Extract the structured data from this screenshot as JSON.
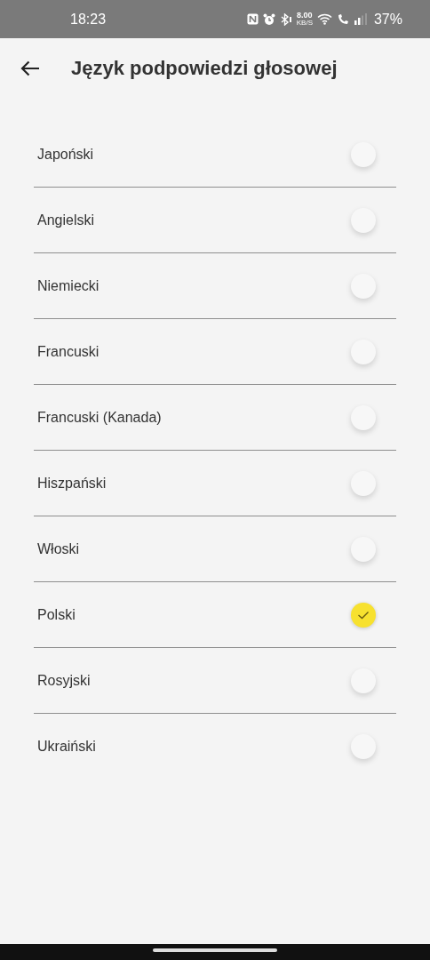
{
  "status_bar": {
    "time": "18:23",
    "speed_value": "8.00",
    "speed_unit": "KB/S",
    "battery": "37%"
  },
  "header": {
    "title": "Język podpowiedzi głosowej"
  },
  "languages": [
    {
      "label": "Japoński",
      "selected": false
    },
    {
      "label": "Angielski",
      "selected": false
    },
    {
      "label": "Niemiecki",
      "selected": false
    },
    {
      "label": "Francuski",
      "selected": false
    },
    {
      "label": "Francuski (Kanada)",
      "selected": false
    },
    {
      "label": "Hiszpański",
      "selected": false
    },
    {
      "label": "Włoski",
      "selected": false
    },
    {
      "label": "Polski",
      "selected": true
    },
    {
      "label": "Rosyjski",
      "selected": false
    },
    {
      "label": "Ukraiński",
      "selected": false
    }
  ]
}
